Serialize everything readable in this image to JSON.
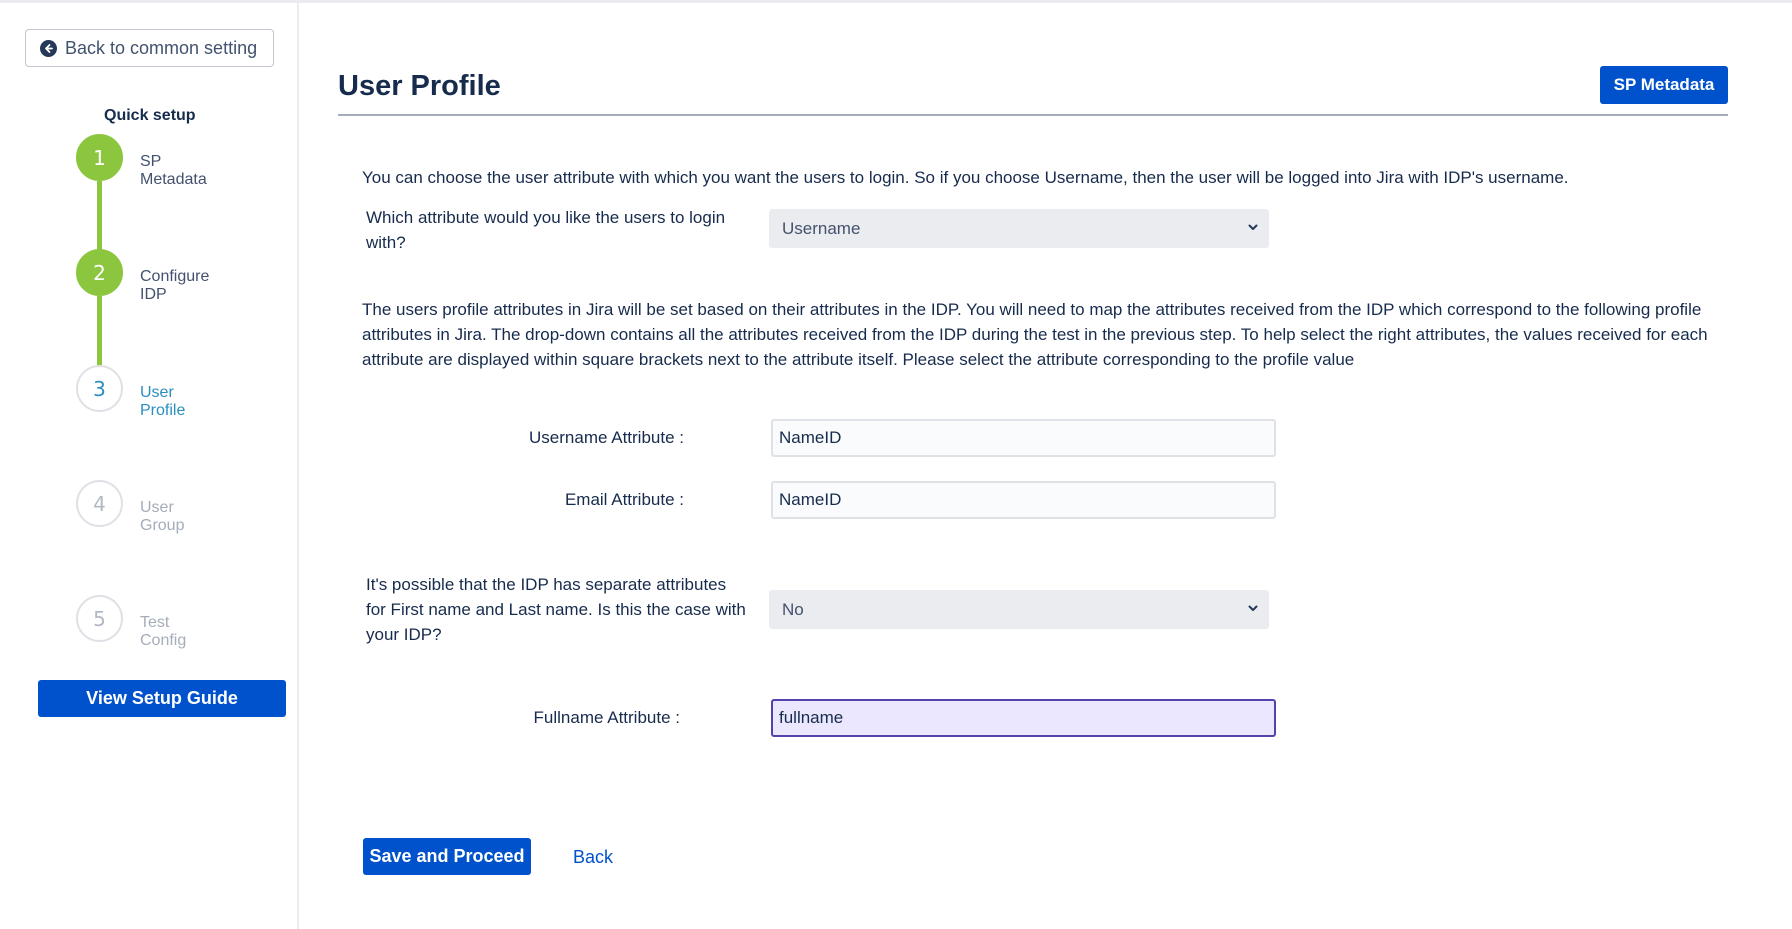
{
  "sidebar": {
    "back_button": "Back to common setting",
    "quick_setup_title": "Quick setup",
    "steps": [
      {
        "number": "1",
        "label": "SP Metadata",
        "state": "done"
      },
      {
        "number": "2",
        "label": "Configure IDP",
        "state": "done"
      },
      {
        "number": "3",
        "label": "User Profile",
        "state": "active"
      },
      {
        "number": "4",
        "label": "User Group",
        "state": "todo"
      },
      {
        "number": "5",
        "label": "Test Config",
        "state": "todo"
      }
    ],
    "guide_button": "View Setup Guide"
  },
  "main": {
    "title": "User Profile",
    "sp_metadata_button": "SP Metadata",
    "login_info": "You can choose the user attribute with which you want the users to login. So if you choose Username, then the user will be logged into Jira with IDP's username.",
    "login_question": "Which attribute would you like the users to login with?",
    "login_select_value": "Username",
    "mapping_info": "The users profile attributes in Jira will be set based on their attributes in the IDP. You will need to map the attributes received from the IDP which correspond to the following profile attributes in Jira. The drop-down contains all the attributes received from the IDP during the test in the previous step. To help select the right attributes, the values received for each attribute are displayed within square brackets next to the attribute itself. Please select the attribute corresponding to the profile value",
    "username_label": "Username Attribute :",
    "username_value": "NameID",
    "email_label": "Email Attribute :",
    "email_value": "NameID",
    "separate_name_question": "It's possible that the IDP has separate attributes for First name and Last name. Is this the case with your IDP?",
    "separate_name_select_value": "No",
    "fullname_label": "Fullname Attribute :",
    "fullname_value": "fullname",
    "save_button": "Save and Proceed",
    "back_link": "Back"
  },
  "colors": {
    "primary": "#0052cc",
    "step_done": "#8cc63f",
    "step_active": "#2a8fbd",
    "focus_border": "#5243aa"
  },
  "icons": {
    "back": "arrow-left-circle-icon",
    "select_chevron": "chevron-down-icon"
  }
}
